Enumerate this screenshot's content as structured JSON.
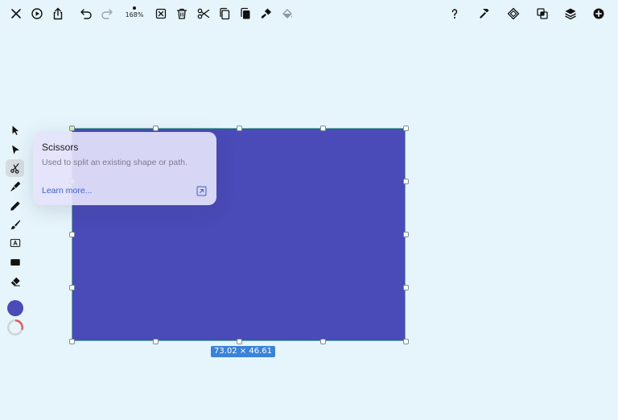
{
  "toolbar": {
    "left_buttons": [
      {
        "name": "close-button",
        "icon": "close-icon"
      },
      {
        "name": "play-button",
        "icon": "play-circle-icon"
      },
      {
        "name": "share-button",
        "icon": "share-icon"
      }
    ],
    "history_buttons": [
      {
        "name": "undo-button",
        "icon": "undo-icon"
      },
      {
        "name": "redo-button",
        "icon": "redo-icon"
      }
    ],
    "zoom_label": "168%",
    "edit_buttons": [
      {
        "name": "deselect-button",
        "icon": "deselect-icon"
      },
      {
        "name": "delete-button",
        "icon": "trash-icon"
      },
      {
        "name": "cut-button",
        "icon": "scissors-icon"
      },
      {
        "name": "copy-button",
        "icon": "copy-icon"
      },
      {
        "name": "paste-button",
        "icon": "paste-icon"
      },
      {
        "name": "style-copy-button",
        "icon": "paint-brush-icon"
      },
      {
        "name": "style-paste-button",
        "icon": "paint-bucket-icon"
      }
    ],
    "right_buttons": [
      {
        "name": "help-button",
        "icon": "question-icon"
      },
      {
        "name": "inspector-button",
        "icon": "hammer-icon"
      },
      {
        "name": "arrange-button",
        "icon": "diamond-icon"
      },
      {
        "name": "boolean-button",
        "icon": "squares-overlap-icon"
      },
      {
        "name": "layers-button",
        "icon": "layers-icon"
      },
      {
        "name": "add-button",
        "icon": "plus-circle-icon"
      }
    ]
  },
  "tools": [
    {
      "name": "select-tool",
      "icon": "arrow-pointer-icon",
      "active": false
    },
    {
      "name": "direct-select-tool",
      "icon": "arrow-solid-icon",
      "active": false
    },
    {
      "name": "scissors-tool",
      "icon": "scissors-icon",
      "active": true
    },
    {
      "name": "pen-tool",
      "icon": "pen-nib-icon",
      "active": false
    },
    {
      "name": "pencil-tool",
      "icon": "pencil-icon",
      "active": false
    },
    {
      "name": "brush-tool",
      "icon": "brush-icon",
      "active": false
    },
    {
      "name": "text-tool",
      "icon": "text-box-icon",
      "active": false
    },
    {
      "name": "rectangle-tool",
      "icon": "rectangle-icon",
      "active": false
    },
    {
      "name": "eraser-tool",
      "icon": "eraser-icon",
      "active": false
    }
  ],
  "colors": {
    "fill": "#4a4ab8",
    "stroke_ring": [
      "#e05a5a",
      "#cfd4d8"
    ],
    "accent": "#3b82d8",
    "selection_border": "#5fb39a",
    "link": "#3d5fc9"
  },
  "tooltip": {
    "title": "Scissors",
    "description": "Used to split an existing shape or path.",
    "link_label": "Learn more...",
    "link_icon": "external-link-icon"
  },
  "selection": {
    "dimensions_label": "73.02 × 46.61"
  }
}
